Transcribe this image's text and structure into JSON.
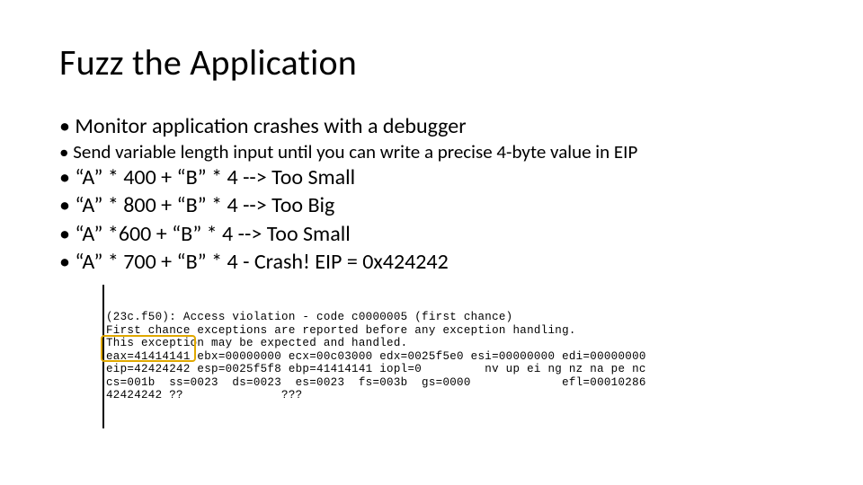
{
  "title": "Fuzz the Application",
  "bullets": {
    "b1": "Monitor application crashes with a debugger",
    "b1a": "Send variable length input until you can write a precise 4-byte value in EIP",
    "s1": "“A” * 400 + “B” * 4 --> Too Small",
    "s2": "“A” * 800 + “B” * 4 --> Too Big",
    "s3": "“A” *600 + “B” * 4 --> Too Small",
    "s4": "“A” * 700 + “B” * 4 - Crash! EIP = 0x424242"
  },
  "dbg": {
    "l1": "(23c.f50): Access violation - code c0000005 (first chance)",
    "l2": "First chance exceptions are reported before any exception handling.",
    "l3": "This exception may be expected and handled.",
    "l4": "eax=41414141 ebx=00000000 ecx=00c03000 edx=0025f5e0 esi=00000000 edi=00000000",
    "l5": "eip=42424242 esp=0025f5f8 ebp=41414141 iopl=0         nv up ei ng nz na pe nc",
    "l6": "cs=001b  ss=0023  ds=0023  es=0023  fs=003b  gs=0000             efl=00010286",
    "l7": "42424242 ??              ???"
  }
}
